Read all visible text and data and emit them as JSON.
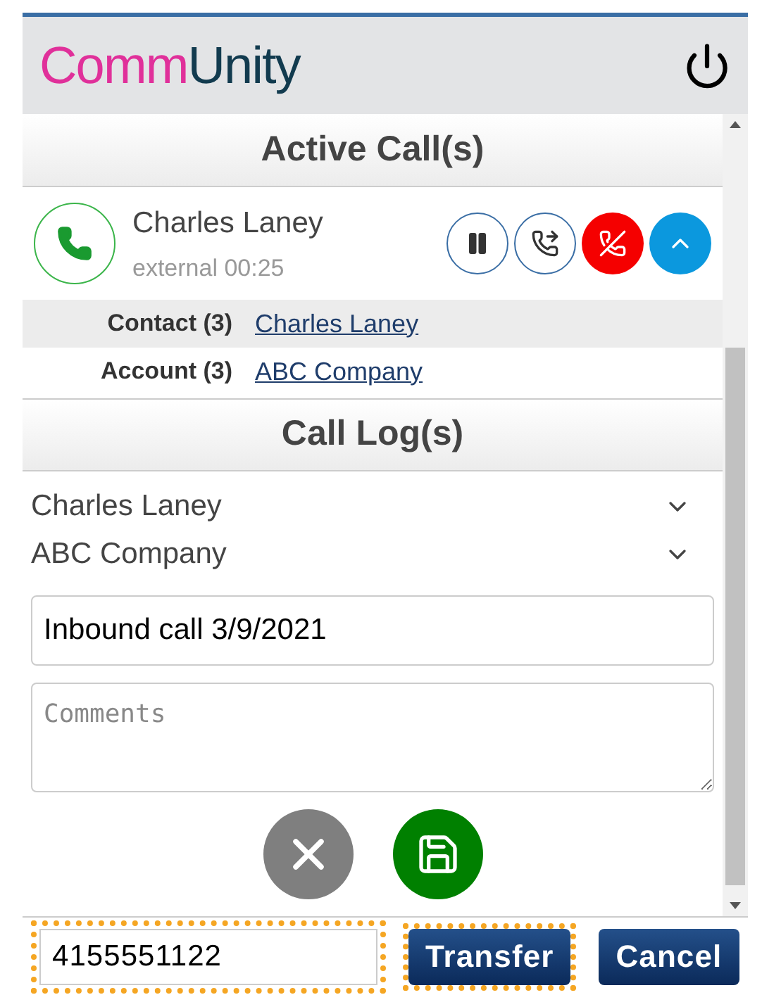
{
  "logo": {
    "first": "Comm",
    "second": "Unity"
  },
  "active_calls": {
    "title": "Active Call(s)",
    "call": {
      "name": "Charles Laney",
      "detail": "external 00:25"
    },
    "related": [
      {
        "label": "Contact (3)",
        "link": "Charles Laney"
      },
      {
        "label": "Account (3)",
        "link": "ABC Company"
      }
    ]
  },
  "call_log": {
    "title": "Call Log(s)",
    "selects": [
      "Charles Laney",
      "ABC Company"
    ],
    "subject": "Inbound call 3/9/2021",
    "comments_placeholder": "Comments"
  },
  "footer": {
    "phone": "4155551122",
    "phone_highlighted": true,
    "buttons": [
      {
        "label": "Transfer",
        "highlighted": true
      },
      {
        "label": "Cancel",
        "highlighted": false
      }
    ]
  }
}
